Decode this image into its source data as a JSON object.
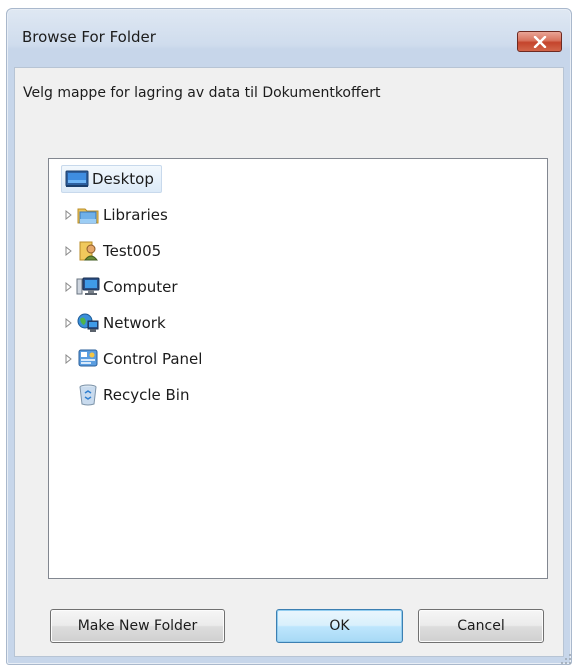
{
  "window": {
    "title": "Browse For Folder",
    "close_glyph": "✕"
  },
  "prompt": "Velg mappe for lagring av data til Dokumentkoffert",
  "tree": {
    "items": [
      {
        "label": "Desktop",
        "icon": "desktop-icon",
        "expandable": false,
        "selected": true
      },
      {
        "label": "Libraries",
        "icon": "libraries-icon",
        "expandable": true,
        "selected": false
      },
      {
        "label": "Test005",
        "icon": "user-folder-icon",
        "expandable": true,
        "selected": false
      },
      {
        "label": "Computer",
        "icon": "computer-icon",
        "expandable": true,
        "selected": false
      },
      {
        "label": "Network",
        "icon": "network-icon",
        "expandable": true,
        "selected": false
      },
      {
        "label": "Control Panel",
        "icon": "control-panel-icon",
        "expandable": true,
        "selected": false
      },
      {
        "label": "Recycle Bin",
        "icon": "recycle-bin-icon",
        "expandable": false,
        "selected": false
      }
    ]
  },
  "buttons": {
    "make_new_folder": "Make New Folder",
    "ok": "OK",
    "cancel": "Cancel"
  },
  "colors": {
    "close_button": "#c4442c",
    "selection": "#dceaf8",
    "default_button_border": "#3c7fb1"
  }
}
